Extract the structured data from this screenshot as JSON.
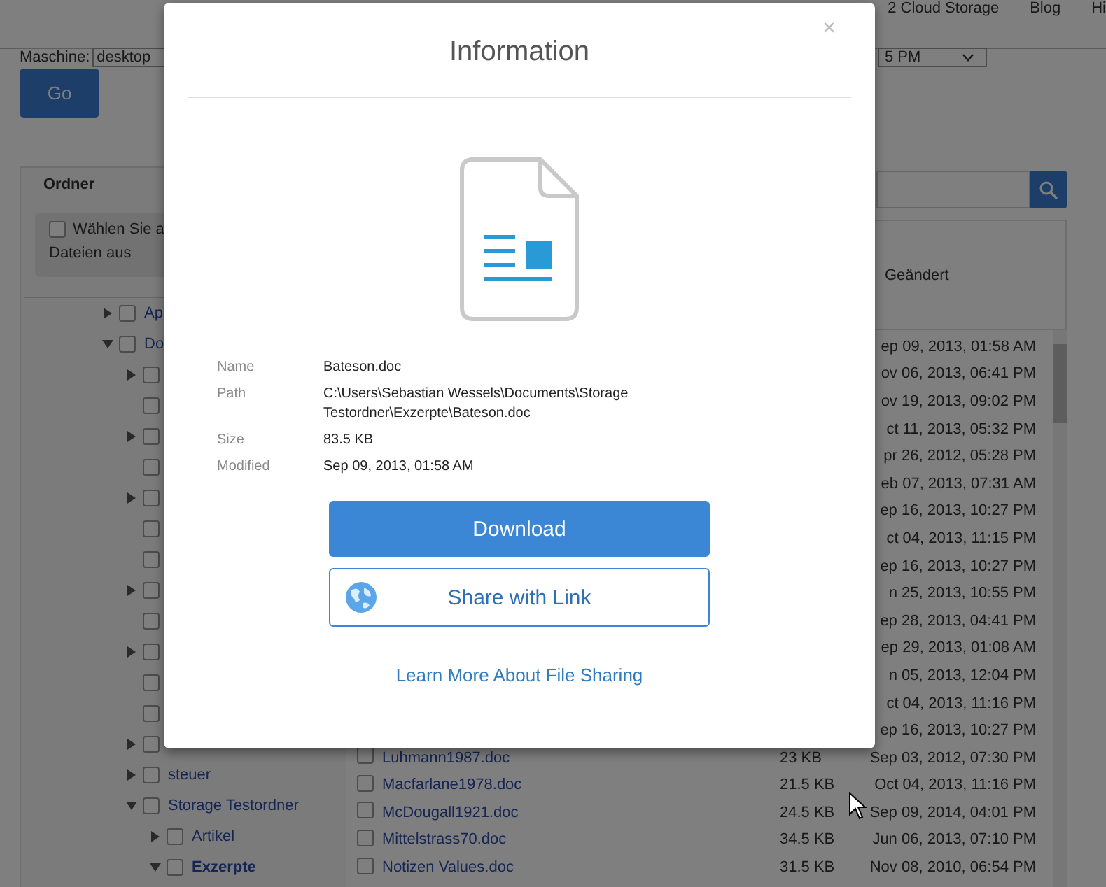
{
  "nav": [
    "2 Cloud Storage",
    "Blog",
    "Hi"
  ],
  "machine": {
    "label": "Maschine:",
    "value": "desktop",
    "time_value": "5 PM"
  },
  "go_button": "Go",
  "folders": {
    "title": "Ordner",
    "select_all": {
      "lines": [
        "Wählen Sie a",
        "Dateien aus"
      ],
      "checked": false
    },
    "tree": [
      {
        "label": "Ap",
        "expanded": false,
        "checked": false,
        "selected": false
      },
      {
        "label": "Do",
        "expanded": true,
        "checked": false,
        "selected": false,
        "children": [
          {
            "expanded": false,
            "checked": false
          },
          {
            "checked": false
          },
          {
            "expanded": false,
            "checked": false
          },
          {
            "checked": false
          },
          {
            "expanded": false,
            "checked": false
          },
          {
            "checked": false
          },
          {
            "checked": false
          },
          {
            "expanded": false,
            "checked": false
          },
          {
            "checked": false
          },
          {
            "expanded": false,
            "checked": false
          },
          {
            "checked": false
          },
          {
            "checked": false
          },
          {
            "expanded": false,
            "checked": false
          },
          {
            "label": "steuer",
            "expanded": false,
            "checked": false,
            "selected": false
          },
          {
            "label": "Storage Testordner",
            "expanded": true,
            "checked": false,
            "selected": false,
            "children": [
              {
                "label": "Artikel",
                "expanded": false,
                "checked": false,
                "selected": false
              },
              {
                "label": "Exzerpte",
                "expanded": true,
                "checked": false,
                "selected": true
              }
            ]
          }
        ]
      }
    ]
  },
  "files": {
    "modified_header": "Geändert",
    "rows": [
      {
        "modified": "ep 09, 2013, 01:58 AM"
      },
      {
        "modified": "ov 06, 2013, 06:41 PM"
      },
      {
        "modified": "ov 19, 2013, 09:02 PM"
      },
      {
        "modified": "ct 11, 2013, 05:32 PM"
      },
      {
        "modified": "pr 26, 2012, 05:28 PM"
      },
      {
        "modified": "eb 07, 2013, 07:31 AM"
      },
      {
        "modified": "ep 16, 2013, 10:27 PM"
      },
      {
        "modified": "ct 04, 2013, 11:15 PM"
      },
      {
        "modified": "ep 16, 2013, 10:27 PM"
      },
      {
        "modified": "n 25, 2013, 10:55 PM"
      },
      {
        "modified": "ep 28, 2013, 04:41 PM"
      },
      {
        "modified": "ep 29, 2013, 01:08 AM"
      },
      {
        "modified": "n 05, 2013, 12:04 PM"
      },
      {
        "modified": "ct 04, 2013, 11:16 PM"
      },
      {
        "modified": "ep 16, 2013, 10:27 PM"
      },
      {
        "name": "Luhmann1987.doc",
        "size": "23 KB",
        "modified": "Sep 03, 2012, 07:30 PM",
        "checked": false
      },
      {
        "name": "Macfarlane1978.doc",
        "size": "21.5 KB",
        "modified": "Oct 04, 2013, 11:16 PM",
        "checked": false
      },
      {
        "name": "McDougall1921.doc",
        "size": "24.5 KB",
        "modified": "Sep 09, 2014, 04:01 PM",
        "checked": false
      },
      {
        "name": "Mittelstrass70.doc",
        "size": "34.5 KB",
        "modified": "Jun 06, 2013, 07:10 PM",
        "checked": false
      },
      {
        "name": "Notizen Values.doc",
        "size": "31.5 KB",
        "modified": "Nov 08, 2010, 06:54 PM",
        "checked": false
      }
    ]
  },
  "modal": {
    "title": "Information",
    "close": "×",
    "info": [
      {
        "label": "Name",
        "value": "Bateson.doc"
      },
      {
        "label": "Path",
        "value": "C:\\Users\\Sebastian Wessels\\Documents\\Storage Testordner\\Exzerpte\\Bateson.doc"
      },
      {
        "label": "Size",
        "value": "83.5 KB"
      },
      {
        "label": "Modified",
        "value": "Sep 09, 2013, 01:58 AM"
      }
    ],
    "download_button": "Download",
    "share_button": "Share with Link",
    "learn_more_link": "Learn More About File Sharing"
  }
}
